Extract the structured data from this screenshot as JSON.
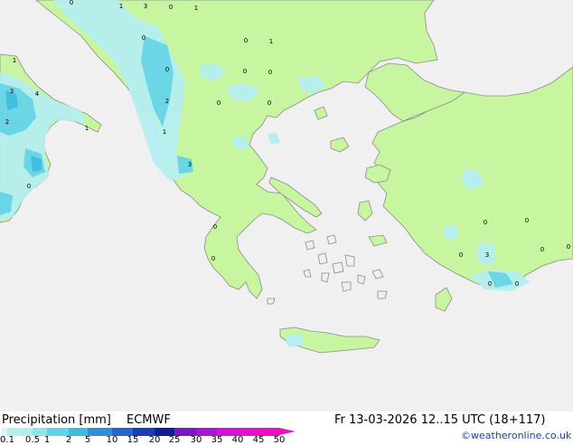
{
  "title": {
    "parameter": "Precipitation [mm]",
    "model": "ECMWF",
    "valid_time": "Fr 13-03-2026 12..15 UTC (18+117)"
  },
  "credit": "©weatheronline.co.uk",
  "colors": {
    "sea": "#f0f0f0",
    "land_dry": "#efefef",
    "land_forecast": "#c7f5a0",
    "coast": "#8c8c8c"
  },
  "legend": {
    "ticks": [
      "0.1",
      "0.5",
      "1",
      "2",
      "5",
      "10",
      "15",
      "20",
      "25",
      "30",
      "35",
      "40",
      "45",
      "50"
    ],
    "colors": [
      "#d7f7f5",
      "#b6eef0",
      "#8fe3ec",
      "#62d3e6",
      "#3cbde0",
      "#2f8fda",
      "#2664cf",
      "#1a3cb8",
      "#101e96",
      "#7a18c8",
      "#a815d6",
      "#d012da",
      "#e40fd0",
      "#ee0cc0"
    ]
  },
  "map_labels": [
    {
      "text": "1"
    },
    {
      "text": "3"
    },
    {
      "text": "0"
    },
    {
      "text": "1"
    },
    {
      "text": "0"
    },
    {
      "text": "0"
    },
    {
      "text": "0"
    },
    {
      "text": "1"
    },
    {
      "text": "0"
    },
    {
      "text": "0"
    },
    {
      "text": "0"
    },
    {
      "text": "3"
    },
    {
      "text": "4"
    },
    {
      "text": "2"
    },
    {
      "text": "2"
    },
    {
      "text": "0"
    },
    {
      "text": "0"
    },
    {
      "text": "1"
    },
    {
      "text": "1"
    },
    {
      "text": "1"
    },
    {
      "text": "3"
    },
    {
      "text": "0"
    },
    {
      "text": "0"
    },
    {
      "text": "0"
    },
    {
      "text": "0"
    },
    {
      "text": "0"
    },
    {
      "text": "0"
    },
    {
      "text": "3"
    },
    {
      "text": "0"
    },
    {
      "text": "0"
    },
    {
      "text": "0"
    },
    {
      "text": "0"
    }
  ]
}
